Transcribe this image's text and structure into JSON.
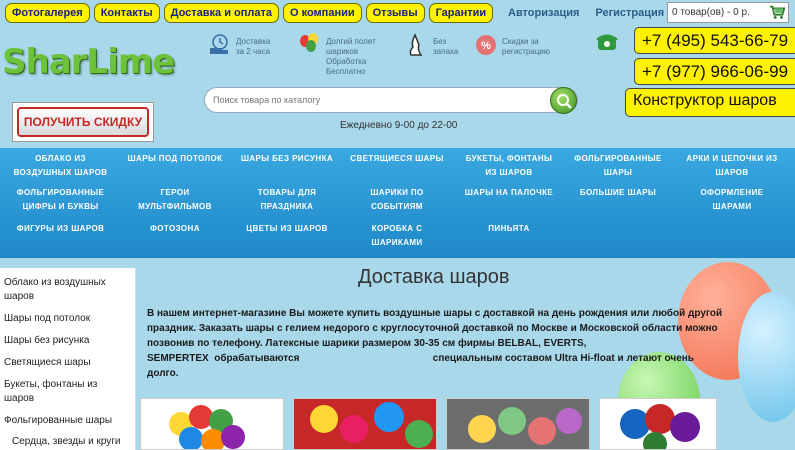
{
  "nav": {
    "items": [
      "Фотогалерея",
      "Контакты",
      "Доставка и оплата",
      "О компании",
      "Отзывы",
      "Гарантии"
    ]
  },
  "auth": {
    "login": "Авторизация",
    "register": "Регистрация"
  },
  "cart": {
    "text": "0 товар(ов) - 0 р."
  },
  "phones": {
    "phone1": "+7 (495) 543-66-79",
    "phone2": "+7 (977) 966-06-99"
  },
  "constructor": {
    "label": "Конструктор шаров"
  },
  "logo": {
    "text": "SharLime"
  },
  "features": [
    {
      "icon": "delivery-truck-icon",
      "text": [
        "Доставка",
        "за 2 часа"
      ]
    },
    {
      "icon": "balloons-icon",
      "text": [
        "Долгий полет",
        "шариков",
        "Обработка",
        "Бесплатно"
      ]
    },
    {
      "icon": "no-smell-icon",
      "text": [
        "Без",
        "запаха"
      ]
    },
    {
      "icon": "discount-icon",
      "text": [
        "Скидки за",
        "регистрацию"
      ]
    }
  ],
  "discount": {
    "label": "ПОЛУЧИТЬ СКИДКУ"
  },
  "search": {
    "placeholder": "Поиск товара по каталогу"
  },
  "hours": "Ежедневно 9-00 до 22-00",
  "categories": [
    [
      "ОБЛАКО ИЗ",
      "ВОЗДУШНЫХ ШАРОВ"
    ],
    [
      "ШАРЫ ПОД ПОТОЛОК"
    ],
    [
      "ШАРЫ БЕЗ РИСУНКА"
    ],
    [
      "СВЕТЯЩИЕСЯ ШАРЫ"
    ],
    [
      "БУКЕТЫ, ФОНТАНЫ",
      "ИЗ ШАРОВ"
    ],
    [
      "ФОЛЬГИРОВАННЫЕ",
      "ШАРЫ"
    ],
    [
      "АРКИ И ЦЕПОЧКИ ИЗ",
      "ШАРОВ"
    ],
    [
      "ФОЛЬГИРОВАННЫЕ",
      "ЦИФРЫ И БУКВЫ"
    ],
    [
      "ГЕРОИ",
      "МУЛЬТФИЛЬМОВ"
    ],
    [
      "ТОВАРЫ ДЛЯ",
      "ПРАЗДНИКА"
    ],
    [
      "ШАРИКИ ПО",
      "СОБЫТИЯМ"
    ],
    [
      "ШАРЫ НА ПАЛОЧКЕ"
    ],
    [
      "БОЛЬШИЕ ШАРЫ"
    ],
    [
      "ОФОРМЛЕНИЕ",
      "ШАРАМИ"
    ],
    [
      "ФИГУРЫ ИЗ ШАРОВ"
    ],
    [
      "ФОТОЗОНА"
    ],
    [
      "ЦВЕТЫ ИЗ ШАРОВ"
    ],
    [
      "КОРОБКА С",
      "ШАРИКАМИ"
    ],
    [
      "ПИНЬЯТА"
    ]
  ],
  "sidebar": {
    "items": [
      "Облако из воздушных шаров",
      "Шары под потолок",
      "Шары без рисунка",
      "Светящиеся шары",
      "Букеты, фонтаны из шаров",
      "Фольгированные шары",
      "Сердца, звезды и круги"
    ]
  },
  "main": {
    "title": "Доставка шаров",
    "intro": [
      "В нашем интернет-магазине Вы можете купить воздушные шары с доставкой на день рождения или любой другой",
      "праздник. Заказать  шары с гелием недорого с круглосуточной доставкой по Москве и Московской области можно",
      "позвонив по телефону. Латексные шарики размером 30-35 см фирмы BELBAL, EVERTS,",
      "SEMPERTEX  обрабатываются                                                специальным составом Ultra Hi-float и летают очень",
      "долго."
    ]
  },
  "colors": {
    "accent_yellow": "#fff200",
    "menu_blue": "#2a98d6",
    "logo_green": "#6cc23a",
    "background": "#a8d8ea"
  }
}
